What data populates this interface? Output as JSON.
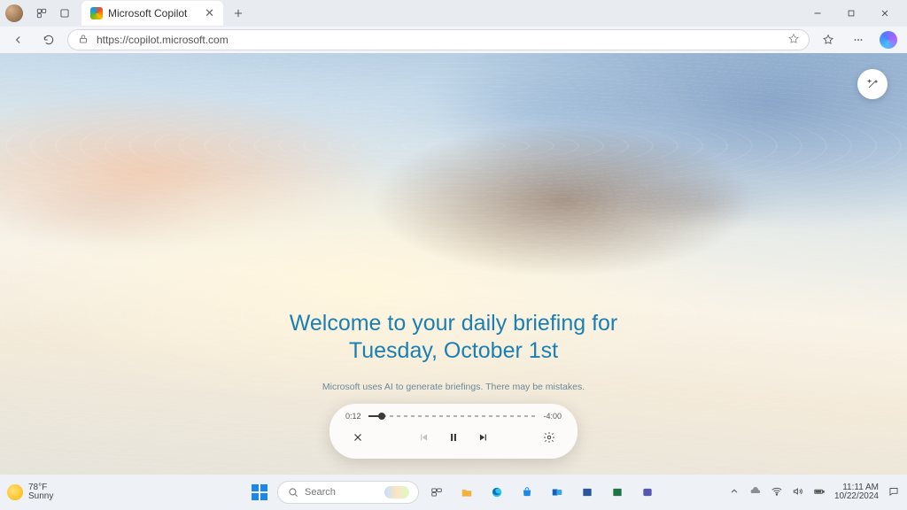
{
  "browser": {
    "tab_title": "Microsoft Copilot",
    "url": "https://copilot.microsoft.com"
  },
  "window_controls": {
    "minimize": "—",
    "maximize": "▢",
    "close": "✕"
  },
  "hero": {
    "line1": "Welcome to your daily briefing for",
    "line2": "Tuesday, October 1st",
    "disclaimer": "Microsoft uses AI to generate briefings. There may be mistakes."
  },
  "player": {
    "elapsed": "0:12",
    "remaining": "-4:00",
    "progress_percent": 8
  },
  "taskbar": {
    "weather_temp": "78°F",
    "weather_desc": "Sunny",
    "search_placeholder": "Search",
    "time": "11:11 AM",
    "date": "10/22/2024"
  }
}
